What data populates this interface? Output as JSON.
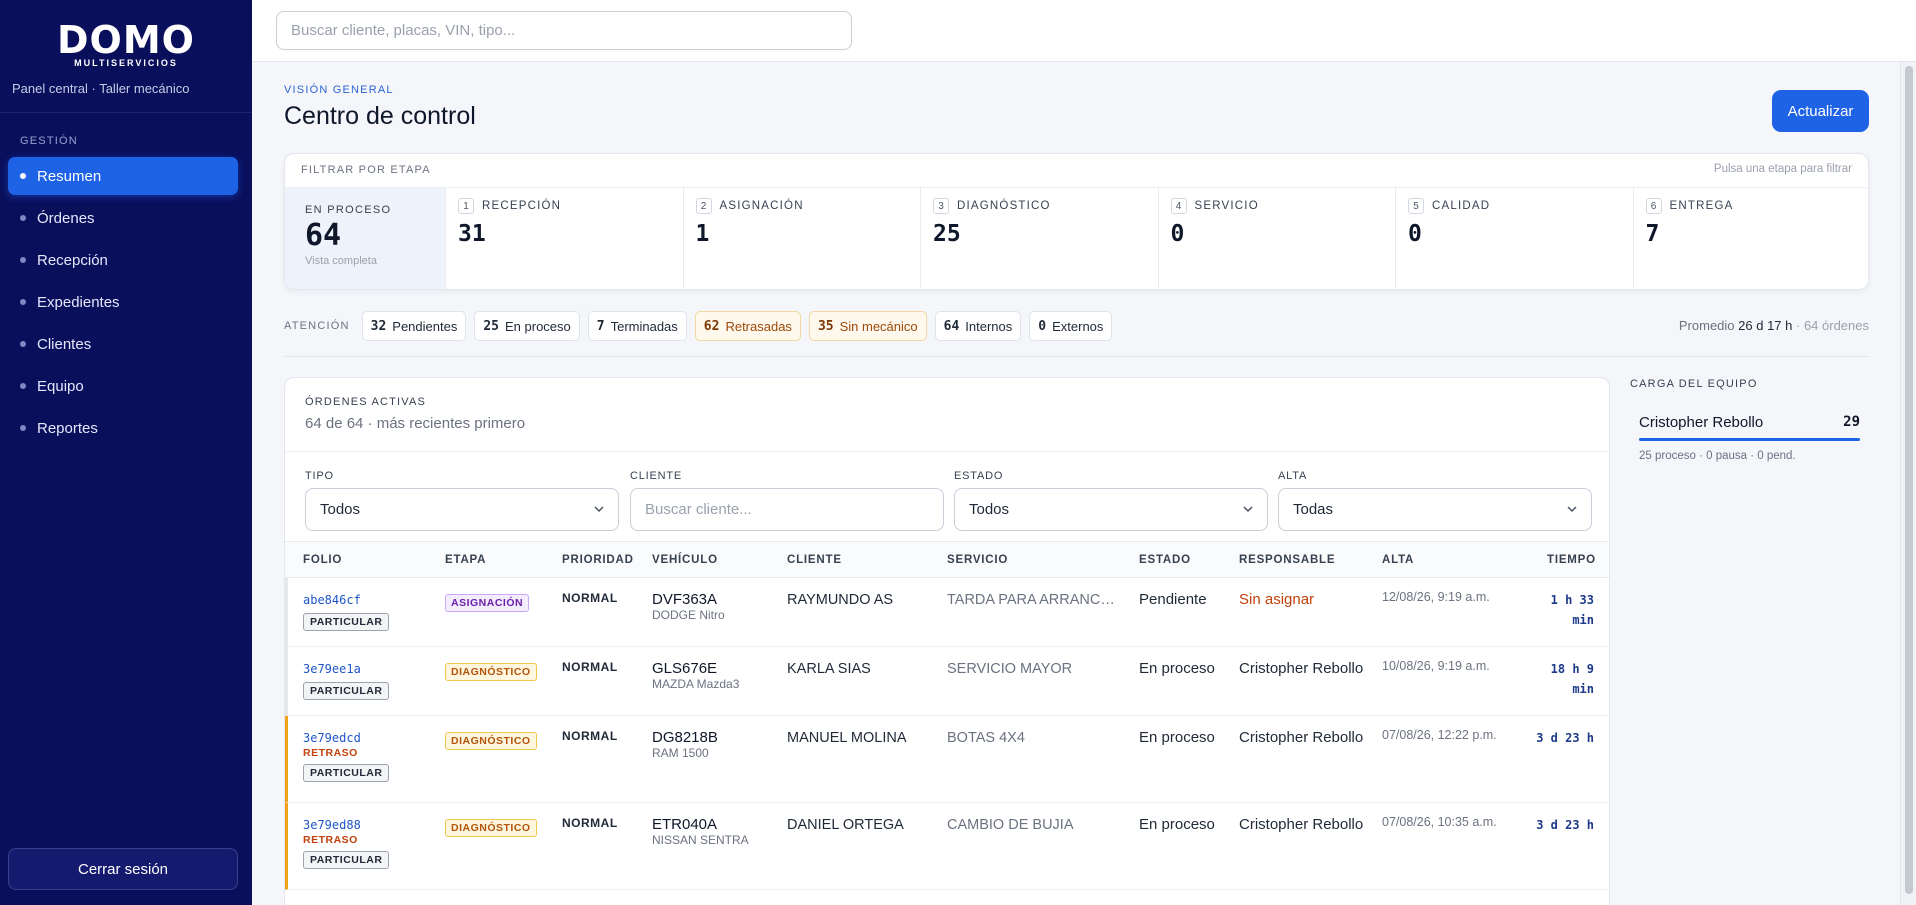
{
  "sidebar": {
    "brand": "DOMO",
    "brand_sub": "MULTISERVICIOS",
    "tagline": "Panel central · Taller mecánico",
    "section": "GESTIÓN",
    "items": [
      {
        "label": "Resumen",
        "active": true
      },
      {
        "label": "Órdenes"
      },
      {
        "label": "Recepción"
      },
      {
        "label": "Expedientes"
      },
      {
        "label": "Clientes"
      },
      {
        "label": "Equipo"
      },
      {
        "label": "Reportes"
      }
    ],
    "logout": "Cerrar sesión"
  },
  "topbar": {
    "search_placeholder": "Buscar cliente, placas, VIN, tipo..."
  },
  "page": {
    "overline": "VISIÓN GENERAL",
    "title": "Centro de control",
    "refresh": "Actualizar"
  },
  "stages": {
    "heading": "FILTRAR POR ETAPA",
    "hint": "Pulsa una etapa para filtrar",
    "total": {
      "label": "EN PROCESO",
      "value": "64",
      "sub": "Vista completa"
    },
    "items": [
      {
        "index": "1",
        "name": "RECEPCIÓN",
        "value": "31"
      },
      {
        "index": "2",
        "name": "ASIGNACIÓN",
        "value": "1"
      },
      {
        "index": "3",
        "name": "DIAGNÓSTICO",
        "value": "25"
      },
      {
        "index": "4",
        "name": "SERVICIO",
        "value": "0"
      },
      {
        "index": "5",
        "name": "CALIDAD",
        "value": "0"
      },
      {
        "index": "6",
        "name": "ENTREGA",
        "value": "7"
      }
    ]
  },
  "attention": {
    "label": "ATENCIÓN",
    "chips": [
      {
        "count": "32",
        "label": "Pendientes"
      },
      {
        "count": "25",
        "label": "En proceso"
      },
      {
        "count": "7",
        "label": "Terminadas"
      },
      {
        "count": "62",
        "label": "Retrasadas",
        "warn": true
      },
      {
        "count": "35",
        "label": "Sin mecánico",
        "warn": true
      },
      {
        "count": "64",
        "label": "Internos"
      },
      {
        "count": "0",
        "label": "Externos"
      }
    ],
    "avg_label": "Promedio",
    "avg_value": "26 d 17 h",
    "avg_orders": "· 64 órdenes"
  },
  "orders": {
    "heading": "ÓRDENES ACTIVAS",
    "sub": "64 de 64 · más recientes primero",
    "filters": {
      "tipo": {
        "label": "TIPO",
        "value": "Todos"
      },
      "cliente": {
        "label": "CLIENTE",
        "placeholder": "Buscar cliente..."
      },
      "estado": {
        "label": "ESTADO",
        "value": "Todos"
      },
      "alta": {
        "label": "ALTA",
        "value": "Todas"
      }
    },
    "columns": {
      "folio": "FOLIO",
      "etapa": "ETAPA",
      "prioridad": "PRIORIDAD",
      "vehiculo": "VEHÍCULO",
      "cliente": "CLIENTE",
      "servicio": "SERVICIO",
      "estado": "ESTADO",
      "responsable": "RESPONSABLE",
      "alta": "ALTA",
      "tiempo": "TIEMPO"
    },
    "rows": [
      {
        "folio": "abe846cf",
        "late": "",
        "type": "PARTICULAR",
        "stage": "ASIGNACIÓN",
        "priority": "NORMAL",
        "plate": "DVF363A",
        "model": "DODGE Nitro",
        "client": "RAYMUNDO AS",
        "service": "TARDA PARA ARRANCAR",
        "status": "Pendiente",
        "responsible": "Sin asignar",
        "created": "12/08/26, 9:19 a.m.",
        "time1": "1 h 33",
        "time2": "min"
      },
      {
        "folio": "3e79ee1a",
        "late": "",
        "type": "PARTICULAR",
        "stage": "DIAGNÓSTICO",
        "priority": "NORMAL",
        "plate": "GLS676E",
        "model": "MAZDA Mazda3",
        "client": "KARLA SIAS",
        "service": "SERVICIO MAYOR",
        "status": "En proceso",
        "responsible": "Cristopher Rebollo",
        "created": "10/08/26, 9:19 a.m.",
        "time1": "18 h 9",
        "time2": "min"
      },
      {
        "folio": "3e79edcd",
        "late": "RETRASO",
        "type": "PARTICULAR",
        "stage": "DIAGNÓSTICO",
        "priority": "NORMAL",
        "plate": "DG8218B",
        "model": "RAM 1500",
        "client": "MANUEL MOLINA",
        "service": "BOTAS 4X4",
        "status": "En proceso",
        "responsible": "Cristopher Rebollo",
        "created": "07/08/26, 12:22 p.m.",
        "time1": "3 d 23 h",
        "time2": ""
      },
      {
        "folio": "3e79ed88",
        "late": "RETRASO",
        "type": "PARTICULAR",
        "stage": "DIAGNÓSTICO",
        "priority": "NORMAL",
        "plate": "ETR040A",
        "model": "NISSAN SENTRA",
        "client": "DANIEL ORTEGA",
        "service": "CAMBIO DE BUJIA",
        "status": "En proceso",
        "responsible": "Cristopher Rebollo",
        "created": "07/08/26, 10:35 a.m.",
        "time1": "3 d 23 h",
        "time2": ""
      }
    ]
  },
  "team": {
    "heading": "CARGA DEL EQUIPO",
    "members": [
      {
        "name": "Cristopher Rebollo",
        "count": "29",
        "detail": "25 proceso · 0 pausa · 0 pend."
      }
    ]
  },
  "colors": {
    "sidebar": "#0a0f5c",
    "accent": "#1e62e6",
    "late": "#f0a21a"
  }
}
